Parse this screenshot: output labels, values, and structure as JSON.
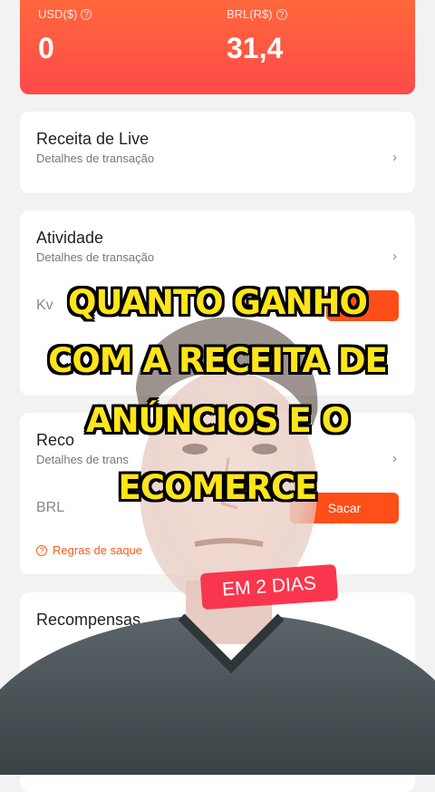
{
  "balances": [
    {
      "label": "USD($)",
      "value": "0"
    },
    {
      "label": "BRL(R$)",
      "value": "31,4"
    }
  ],
  "cards": {
    "live": {
      "title": "Receita de Live",
      "subtitle": "Detalhes de transação"
    },
    "activity": {
      "title": "Atividade",
      "subtitle": "Detalhes de transação",
      "row_label": "Kv"
    },
    "ads": {
      "title": "Reco",
      "subtitle": "Detalhes de trans",
      "row_label": "BRL",
      "button": "Sacar",
      "rules": "Regras de saque"
    },
    "rewards": {
      "title": "Recompensas"
    }
  },
  "overlay": {
    "caption_lines": [
      "QUANTO GANHO",
      "COM A RECEITA DE",
      "ANÚNCIOS E O",
      "ECOMERCE"
    ],
    "pill": "EM 2 DIAS"
  },
  "colors": {
    "accent": "#ff4e17",
    "caption": "#ffe51a",
    "pill": "#f9364e"
  }
}
